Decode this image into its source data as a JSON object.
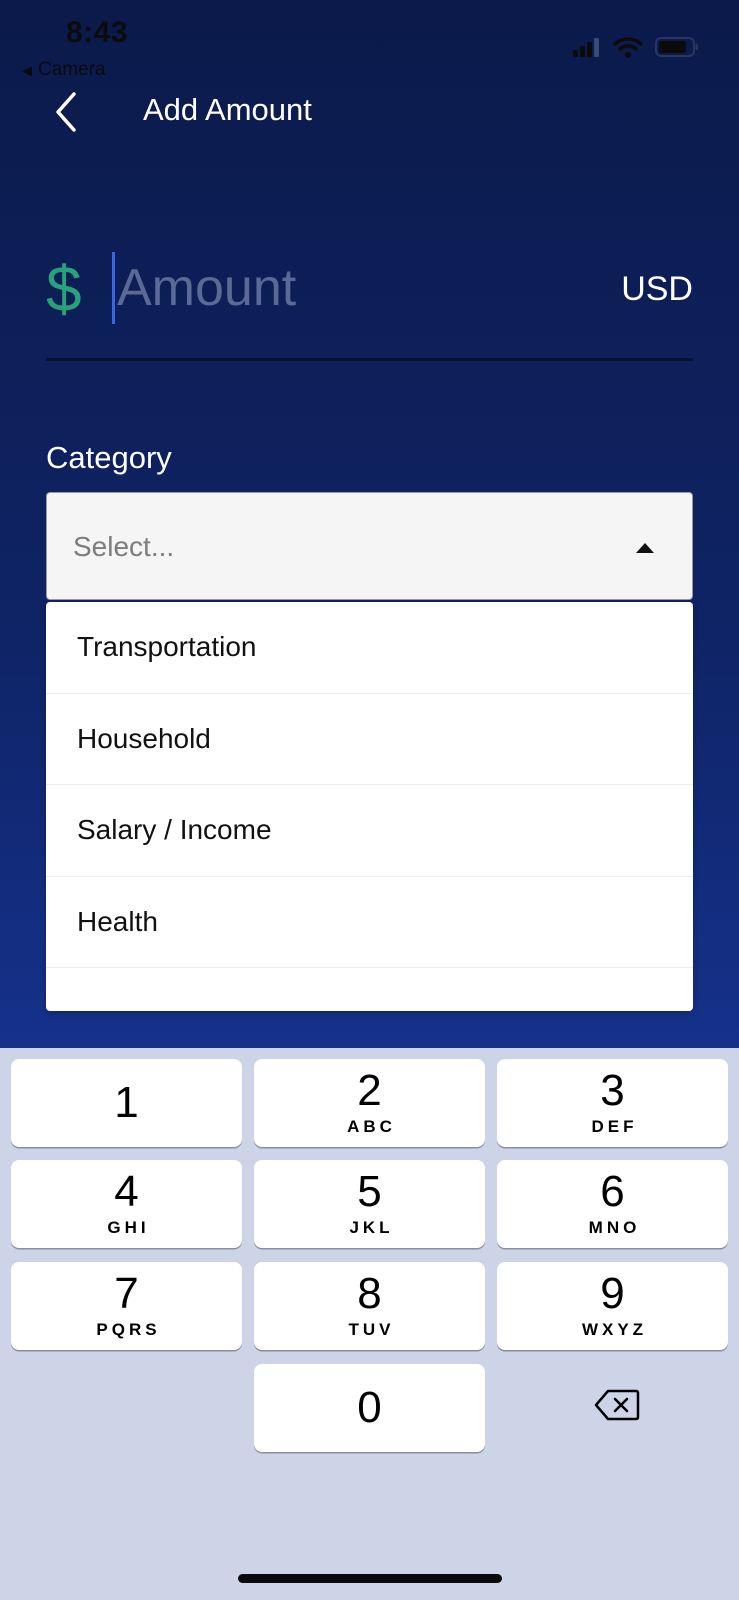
{
  "status_bar": {
    "time": "8:43",
    "back_app_label": "Camera",
    "icons": [
      "cellular-signal-icon",
      "wifi-icon",
      "battery-icon"
    ]
  },
  "nav": {
    "back_icon": "chevron-left-icon",
    "title": "Add Amount"
  },
  "amount": {
    "currency_symbol": "$",
    "placeholder": "Amount",
    "value": "",
    "currency_code": "USD"
  },
  "category": {
    "label": "Category",
    "select_placeholder": "Select...",
    "options": [
      "Transportation",
      "Household",
      "Salary / Income",
      "Health"
    ]
  },
  "keyboard": {
    "keys": [
      {
        "number": "1",
        "letters": ""
      },
      {
        "number": "2",
        "letters": "ABC"
      },
      {
        "number": "3",
        "letters": "DEF"
      },
      {
        "number": "4",
        "letters": "GHI"
      },
      {
        "number": "5",
        "letters": "JKL"
      },
      {
        "number": "6",
        "letters": "MNO"
      },
      {
        "number": "7",
        "letters": "PQRS"
      },
      {
        "number": "8",
        "letters": "TUV"
      },
      {
        "number": "9",
        "letters": "WXYZ"
      },
      {
        "number": "0",
        "letters": ""
      }
    ],
    "delete_icon": "backspace-icon"
  },
  "colors": {
    "background_top": "#0b1a4a",
    "background_bottom": "#1a3a9a",
    "currency_symbol": "#27a27a",
    "cursor": "#3a64e0",
    "keyboard_background": "#cdd4e8"
  }
}
